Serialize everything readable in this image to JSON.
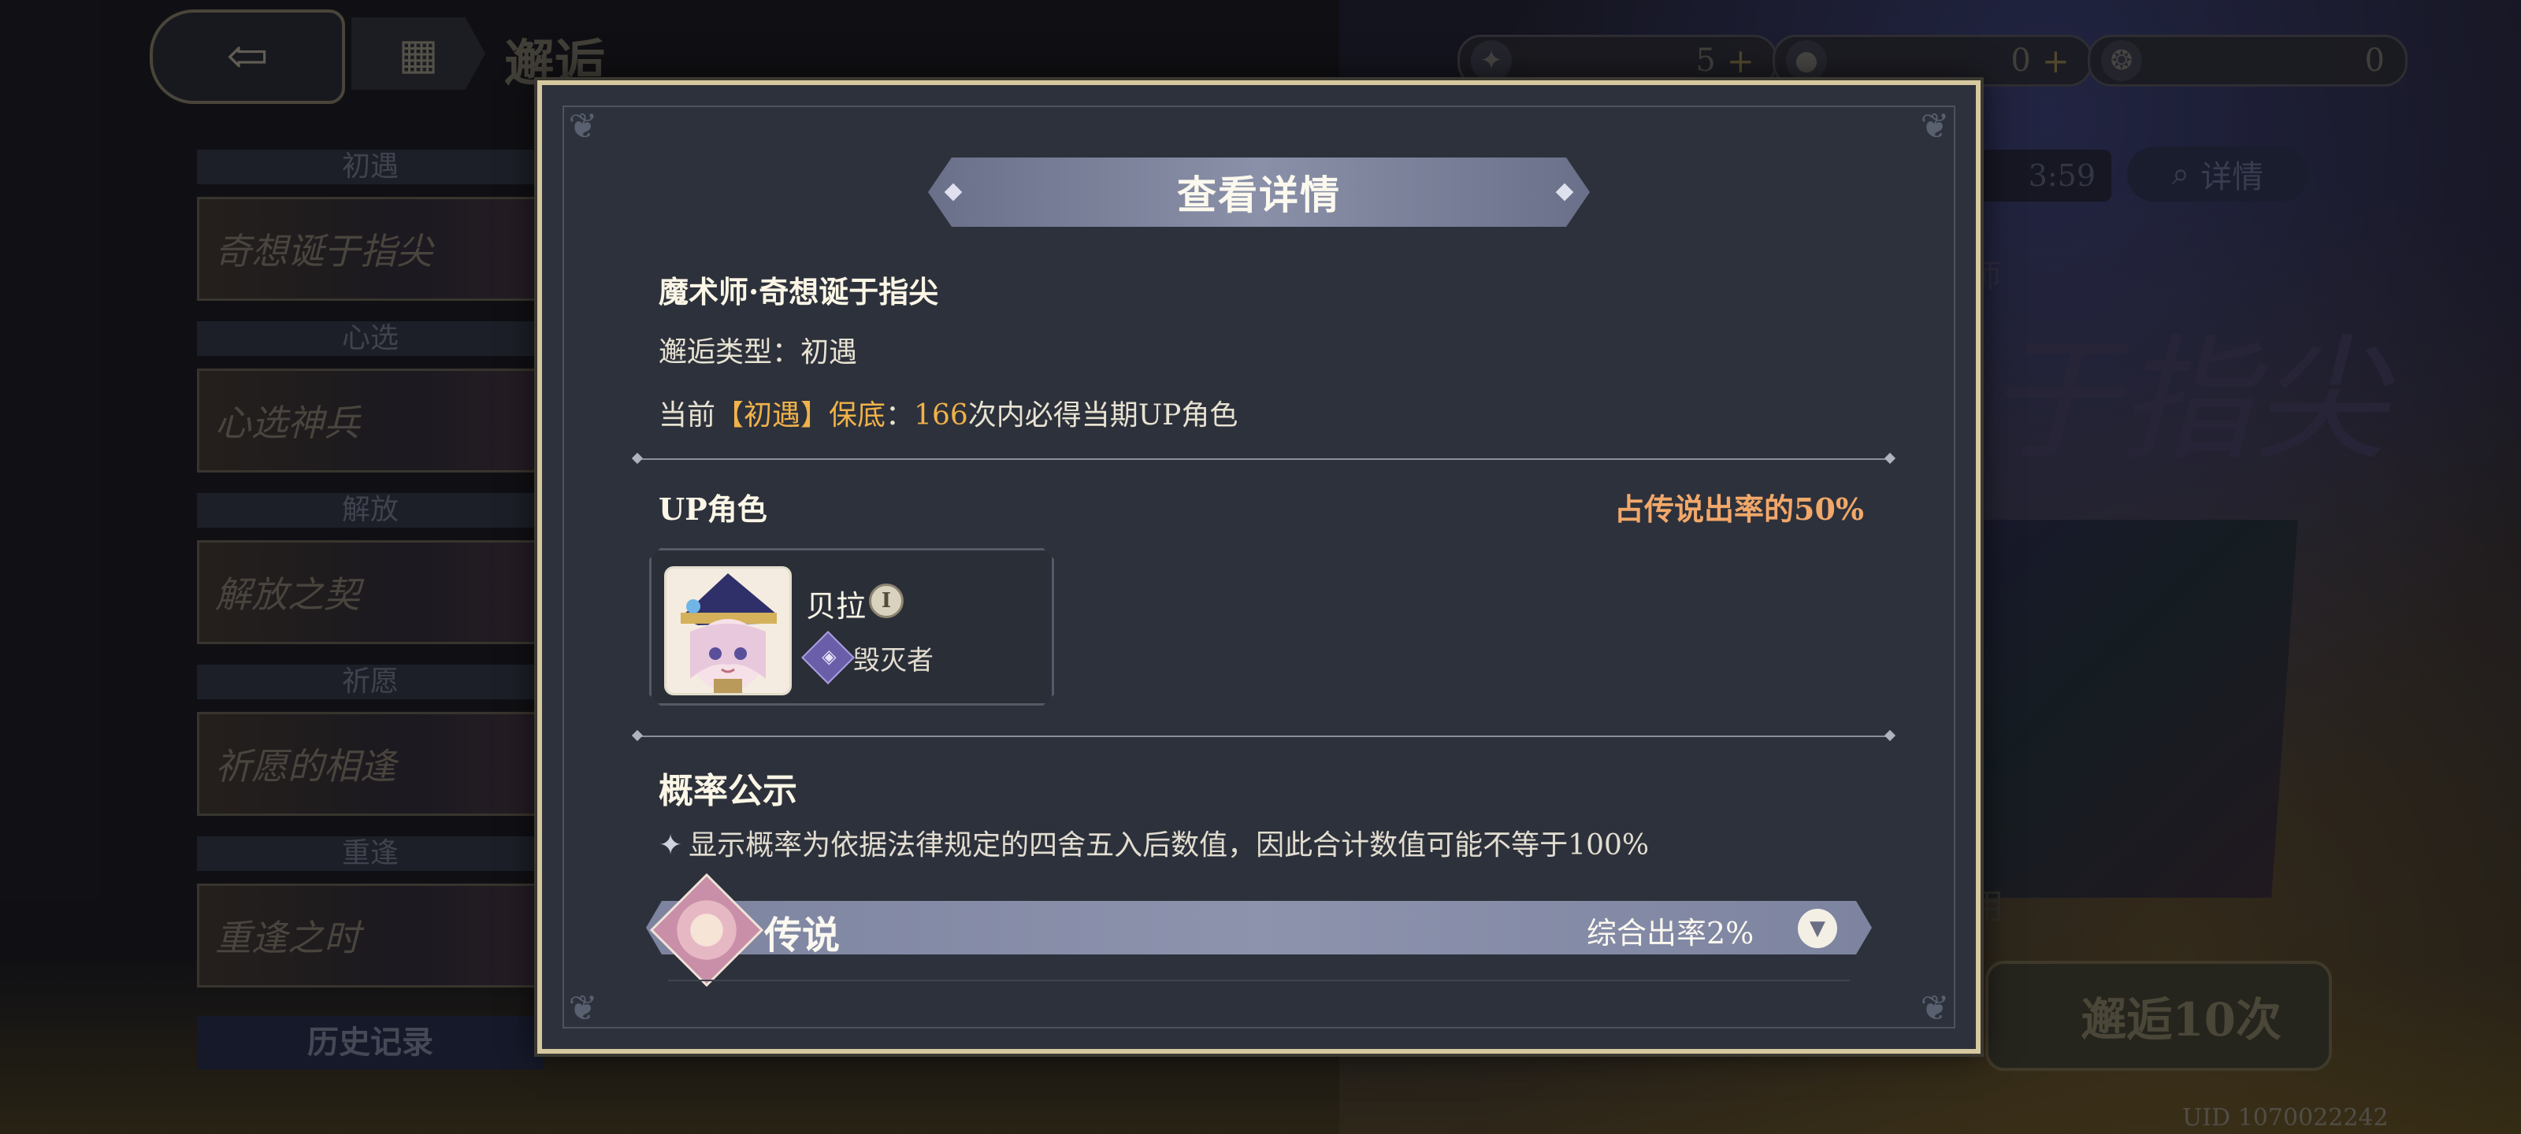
{
  "background": {
    "page_title": "邂逅",
    "currencies": [
      {
        "icon": "star-compass-icon",
        "amount": "5",
        "has_plus": true
      },
      {
        "icon": "crystal-orb-icon",
        "amount": "0",
        "has_plus": true
      },
      {
        "icon": "gold-emblem-icon",
        "amount": "0",
        "has_plus": false
      }
    ],
    "banners": [
      {
        "category": "初遇",
        "name": "奇想诞于指尖"
      },
      {
        "category": "心选",
        "name": "心选神兵"
      },
      {
        "category": "解放",
        "name": "解放之契"
      },
      {
        "category": "祈愿",
        "name": "祈愿的相逢"
      },
      {
        "category": "重逢",
        "name": "重逢之时"
      }
    ],
    "history_label": "历史记录",
    "timer_fragment": "3:59",
    "detail_label": "详情",
    "banner_title_fragment": "于指尖",
    "banner_small_fragment": "师",
    "use_fragment": "用",
    "pull_label": "邂逅10次",
    "pull_count": "10",
    "uid": "UID 1070022242"
  },
  "modal": {
    "title": "查看详情",
    "banner_name": "魔术师·奇想诞于指尖",
    "encounter_type_label": "邂逅类型：",
    "encounter_type_value": "初遇",
    "pity_prefix": "当前",
    "pity_tag": "【初遇】保底",
    "pity_colon": "：",
    "pity_count": "166",
    "pity_suffix": "次内必得当期UP角色",
    "up_section_title": "UP角色",
    "up_rate_note": "占传说出率的50%",
    "up_character": {
      "name": "贝拉",
      "badge": "I",
      "class": "毁灭者",
      "class_icon": "destroyer-class-icon"
    },
    "probability_title": "概率公示",
    "probability_note_icon": "✦",
    "probability_note": "显示概率为依据法律规定的四舍五入后数值，因此合计数值可能不等于100%",
    "rarity_rows": [
      {
        "label": "传说",
        "rate": "综合出率2%",
        "expanded": false
      }
    ]
  },
  "colors": {
    "modal_border": "#d6c9a0",
    "modal_bg": "#2d313b",
    "gold_text": "#f0b24a",
    "orange_text": "#f2a86a",
    "header_bar": "#8a90a8"
  }
}
